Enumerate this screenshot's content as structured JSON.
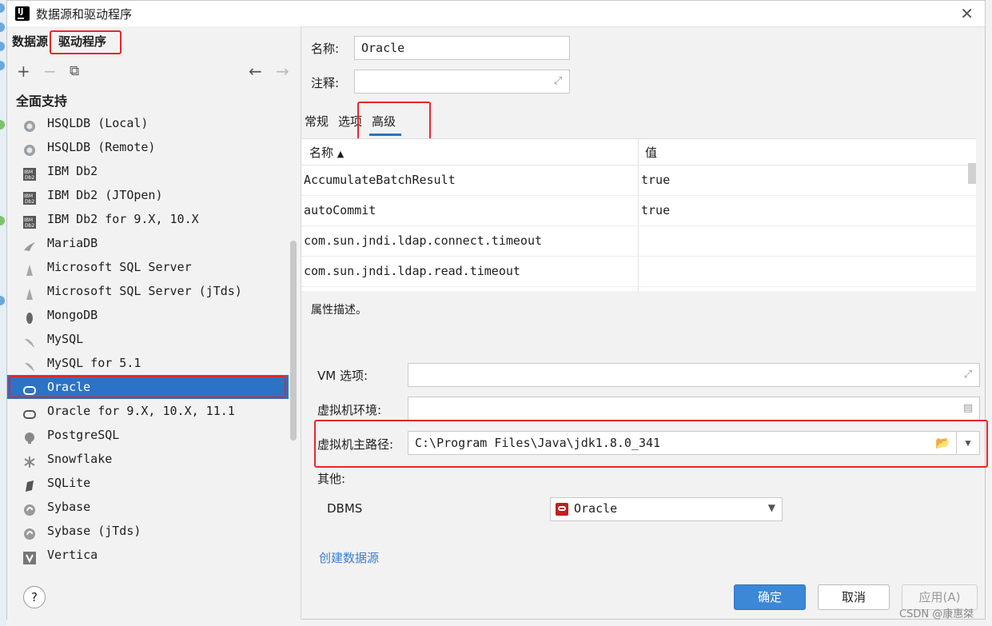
{
  "window": {
    "title": "数据源和驱动程序"
  },
  "left": {
    "tabs": [
      "数据源",
      "驱动程序"
    ],
    "toolbar": {
      "add": "+",
      "remove": "−",
      "copy": "⧉",
      "back": "←",
      "forward": "→"
    },
    "section": "全面支持",
    "items": [
      {
        "label": "HSQLDB (Local)",
        "icon": "hsqldb-icon"
      },
      {
        "label": "HSQLDB (Remote)",
        "icon": "hsqldb-icon"
      },
      {
        "label": "IBM Db2",
        "icon": "ibm-db2-icon"
      },
      {
        "label": "IBM Db2 (JTOpen)",
        "icon": "ibm-db2-icon"
      },
      {
        "label": "IBM Db2 for 9.X, 10.X",
        "icon": "ibm-db2-icon"
      },
      {
        "label": "MariaDB",
        "icon": "mariadb-icon"
      },
      {
        "label": "Microsoft SQL Server",
        "icon": "sqlserver-icon"
      },
      {
        "label": "Microsoft SQL Server (jTds)",
        "icon": "sqlserver-icon"
      },
      {
        "label": "MongoDB",
        "icon": "mongodb-icon"
      },
      {
        "label": "MySQL",
        "icon": "mysql-icon"
      },
      {
        "label": "MySQL for 5.1",
        "icon": "mysql-icon"
      },
      {
        "label": "Oracle",
        "icon": "oracle-icon",
        "selected": true
      },
      {
        "label": "Oracle for 9.X, 10.X, 11.1",
        "icon": "oracle-icon"
      },
      {
        "label": "PostgreSQL",
        "icon": "postgresql-icon"
      },
      {
        "label": "Snowflake",
        "icon": "snowflake-icon"
      },
      {
        "label": "SQLite",
        "icon": "sqlite-icon"
      },
      {
        "label": "Sybase",
        "icon": "sybase-icon"
      },
      {
        "label": "Sybase (jTds)",
        "icon": "sybase-icon"
      },
      {
        "label": "Vertica",
        "icon": "vertica-icon"
      }
    ],
    "help": "?"
  },
  "right": {
    "name_label": "名称:",
    "name_value": "Oracle",
    "comment_label": "注释:",
    "comment_value": "",
    "tabs": [
      "常规",
      "选项",
      "高级"
    ],
    "table": {
      "col_name": "名称",
      "col_value": "值",
      "rows": [
        {
          "name": "AccumulateBatchResult",
          "value": "true"
        },
        {
          "name": "autoCommit",
          "value": "true"
        },
        {
          "name": "com.sun.jndi.ldap.connect.timeout",
          "value": ""
        },
        {
          "name": "com.sun.jndi.ldap.read.timeout",
          "value": ""
        }
      ]
    },
    "description": "属性描述。",
    "vm_options_label": "VM 选项:",
    "vm_env_label": "虚拟机环境:",
    "vm_home_label": "虚拟机主路径:",
    "vm_home_value": "C:\\Program Files\\Java\\jdk1.8.0_341",
    "other_label": "其他:",
    "dbms_label": "DBMS",
    "dbms_value": "Oracle",
    "create_link": "创建数据源"
  },
  "buttons": {
    "ok": "确定",
    "cancel": "取消",
    "apply": "应用(A)"
  },
  "watermark": "CSDN @康惠桀",
  "colors": {
    "accent": "#2a73c7",
    "highlight_box": "#e8262a",
    "oracle_red": "#c41e1e"
  }
}
